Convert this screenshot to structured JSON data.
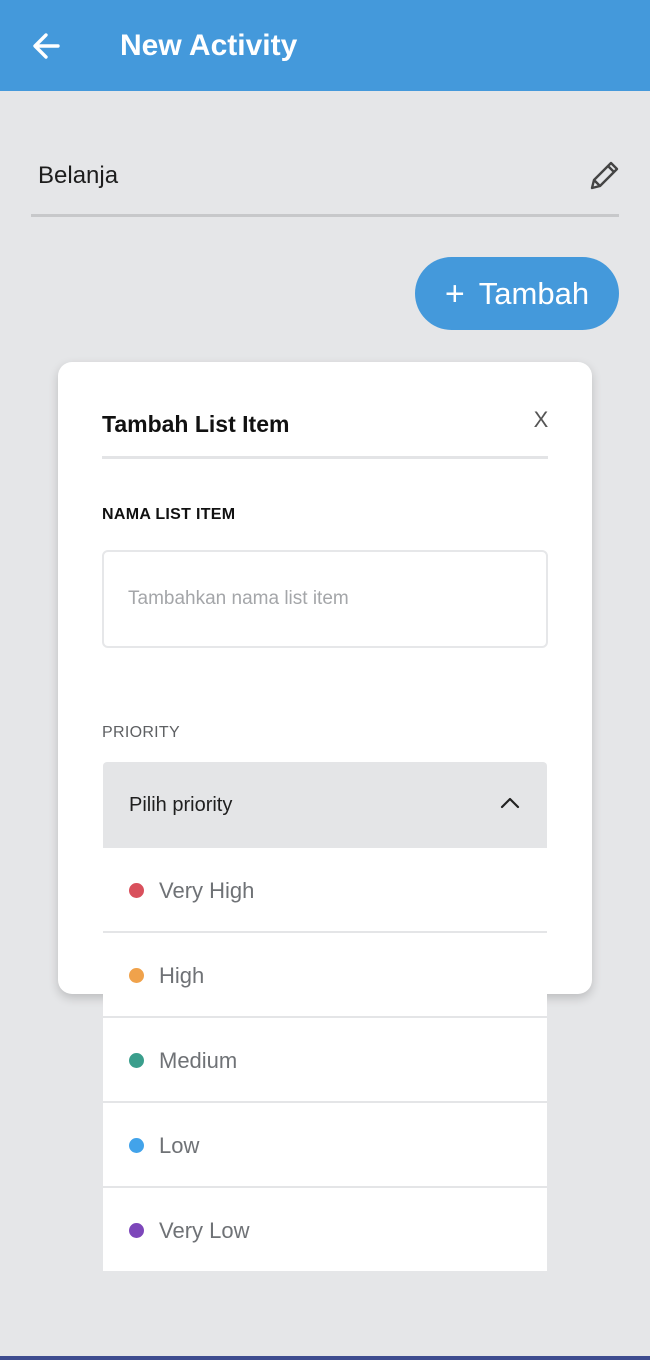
{
  "appbar": {
    "title": "New Activity",
    "back_icon": "arrow-left-icon",
    "color": "#4499db"
  },
  "activity": {
    "title": "Belanja",
    "edit_icon": "pencil-icon"
  },
  "add_button": {
    "icon": "plus-icon",
    "icon_glyph": "+",
    "label": "Tambah"
  },
  "modal": {
    "title": "Tambah List Item",
    "close_label": "X",
    "name_field": {
      "label": "NAMA LIST ITEM",
      "value": "",
      "placeholder": "Tambahkan nama list item"
    },
    "priority_field": {
      "label": "PRIORITY",
      "selected": "Pilih priority",
      "chevron_icon": "chevron-up-icon",
      "expanded": true,
      "options": [
        {
          "label": "Very High",
          "color": "#d9505c"
        },
        {
          "label": "High",
          "color": "#f0a24b"
        },
        {
          "label": "Medium",
          "color": "#3a9e8c"
        },
        {
          "label": "Low",
          "color": "#42a3ea"
        },
        {
          "label": "Very Low",
          "color": "#7d47ba"
        }
      ]
    }
  }
}
